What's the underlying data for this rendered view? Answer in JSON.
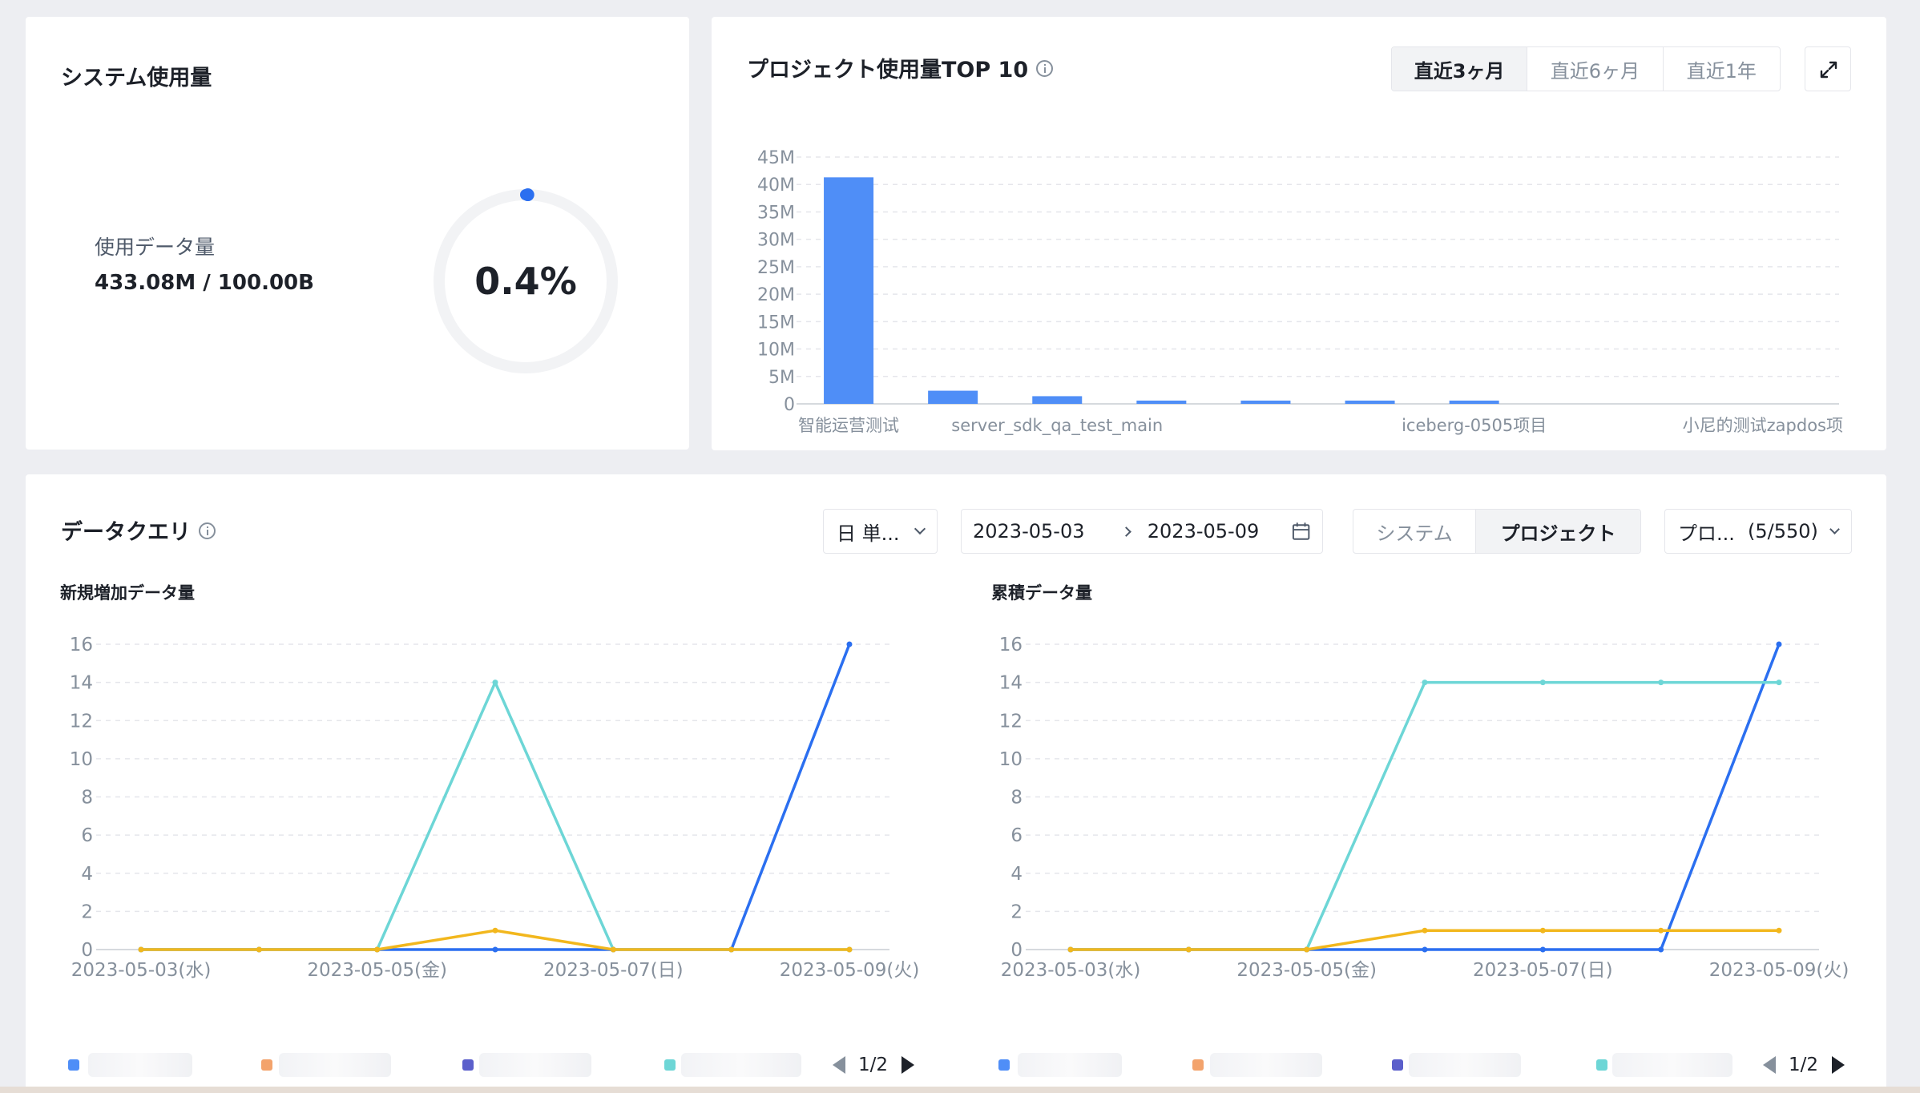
{
  "system_usage": {
    "title": "システム使用量",
    "label": "使用データ量",
    "value": "433.08M / 100.00B",
    "percent_text": "0.4%",
    "percent": 0.4
  },
  "top10": {
    "title": "プロジェクト使用量TOP 10",
    "ranges": [
      "直近3ヶ月",
      "直近6ヶ月",
      "直近1年"
    ],
    "active_range": 0
  },
  "query": {
    "title": "データクエリ",
    "granularity": "日 単...",
    "date_start": "2023-05-03",
    "date_end": "2023-05-09",
    "scope_tabs": [
      "システム",
      "プロジェクト"
    ],
    "active_scope": 1,
    "project_select": "プロ...",
    "project_count": "(5/550)",
    "left_chart_title": "新規増加データ量",
    "right_chart_title": "累積データ量",
    "legend_page": "1/2"
  },
  "colors": {
    "accent": "#4f8ef7",
    "blue": "#2b6ff0",
    "cyan": "#6dd6d6",
    "yellow": "#f2b71d",
    "orange": "#f3a36c",
    "purple": "#5b5fcb"
  },
  "chart_data": [
    {
      "type": "bar",
      "title": "プロジェクト使用量TOP 10",
      "categories": [
        "智能运营测试",
        "",
        "server_sdk_qa_test_main",
        "",
        "",
        "",
        "iceberg-0505项目",
        "",
        "",
        "小尼的测试zapdos项"
      ],
      "values": [
        41.3,
        2.4,
        1.4,
        0.6,
        0.6,
        0.6,
        0.6,
        0,
        0,
        0
      ],
      "y_ticks": [
        "0",
        "5M",
        "10M",
        "15M",
        "20M",
        "25M",
        "30M",
        "35M",
        "40M",
        "45M"
      ],
      "ylim": [
        0,
        45
      ],
      "grid": true
    },
    {
      "type": "line",
      "title": "新規増加データ量",
      "x": [
        "2023-05-03(水)",
        "2023-05-04",
        "2023-05-05(金)",
        "2023-05-06",
        "2023-05-07(日)",
        "2023-05-08",
        "2023-05-09(火)"
      ],
      "x_tick_labels": [
        "2023-05-03(水)",
        "2023-05-05(金)",
        "2023-05-07(日)",
        "2023-05-09(火)"
      ],
      "y_ticks": [
        "0",
        "2",
        "4",
        "6",
        "8",
        "10",
        "12",
        "14",
        "16"
      ],
      "ylim": [
        0,
        16
      ],
      "grid": true,
      "series": [
        {
          "values": [
            0,
            0,
            0,
            0,
            0,
            0,
            16
          ]
        },
        {
          "values": [
            0,
            0,
            0,
            14,
            0,
            0,
            0
          ]
        },
        {
          "values": [
            0,
            0,
            0,
            1,
            0,
            0,
            0
          ]
        }
      ]
    },
    {
      "type": "line",
      "title": "累積データ量",
      "x": [
        "2023-05-03(水)",
        "2023-05-04",
        "2023-05-05(金)",
        "2023-05-06",
        "2023-05-07(日)",
        "2023-05-08",
        "2023-05-09(火)"
      ],
      "x_tick_labels": [
        "2023-05-03(水)",
        "2023-05-05(金)",
        "2023-05-07(日)",
        "2023-05-09(火)"
      ],
      "y_ticks": [
        "0",
        "2",
        "4",
        "6",
        "8",
        "10",
        "12",
        "14",
        "16"
      ],
      "ylim": [
        0,
        16
      ],
      "grid": true,
      "series": [
        {
          "values": [
            0,
            0,
            0,
            0,
            0,
            0,
            16
          ]
        },
        {
          "values": [
            0,
            0,
            0,
            14,
            14,
            14,
            14
          ]
        },
        {
          "values": [
            0,
            0,
            0,
            1,
            1,
            1,
            1
          ]
        }
      ]
    }
  ]
}
